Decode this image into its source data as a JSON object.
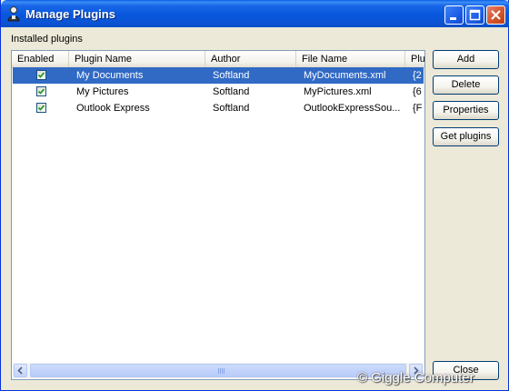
{
  "window": {
    "title": "Manage Plugins"
  },
  "group_label": "Installed plugins",
  "columns": [
    "Enabled",
    "Plugin Name",
    "Author",
    "File Name",
    "Plu"
  ],
  "rows": [
    {
      "enabled": true,
      "name": "My Documents",
      "author": "Softland",
      "file": "MyDocuments.xml",
      "id": "{2",
      "selected": true
    },
    {
      "enabled": true,
      "name": "My Pictures",
      "author": "Softland",
      "file": "MyPictures.xml",
      "id": "{6",
      "selected": false
    },
    {
      "enabled": true,
      "name": "Outlook Express",
      "author": "Softland",
      "file": "OutlookExpressSou...",
      "id": "{F",
      "selected": false
    }
  ],
  "buttons": {
    "add": "Add",
    "delete": "Delete",
    "properties": "Properties",
    "get_plugins": "Get plugins",
    "close": "Close"
  },
  "watermark": "© Giggle Computer",
  "icons": {
    "app": "plugin-app-icon",
    "minimize": "minimize-icon",
    "maximize": "maximize-icon",
    "close": "close-icon"
  },
  "colors": {
    "selection": "#316ac5",
    "titlebar": "#0856dc",
    "checkmark": "#21a121"
  }
}
